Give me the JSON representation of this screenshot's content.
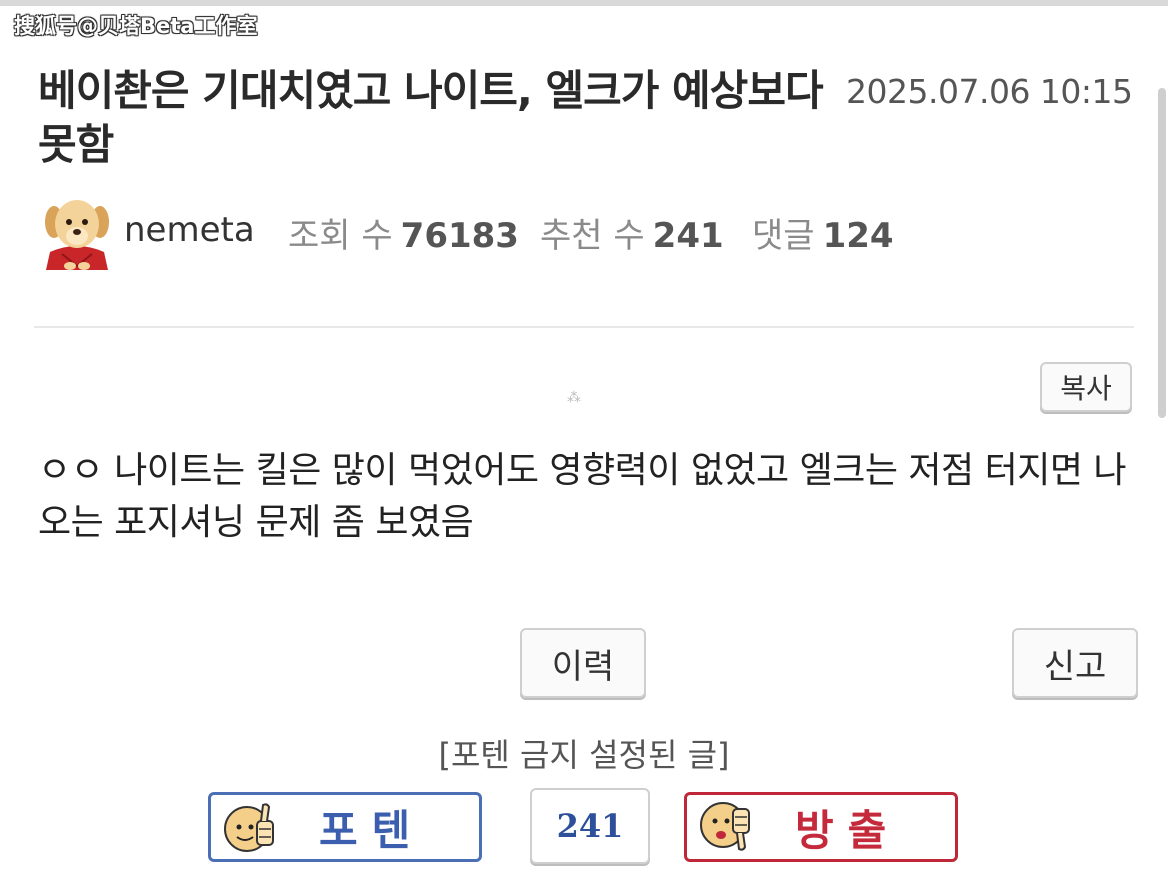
{
  "watermark": "搜狐号@贝塔Beta工作室",
  "post": {
    "title": "베이촨은 기대치였고 나이트, 엘크가 예상보다 못함",
    "datetime": "2025.07.06 10:15",
    "author": "nemeta",
    "stats": {
      "views_label": "조회 수",
      "views_value": "76183",
      "recommend_label": "추천 수",
      "recommend_value": "241",
      "comments_label": "댓글",
      "comments_value": "124"
    },
    "copy_label": "복사",
    "body": "ㅇㅇ 나이트는 킬은 많이 먹었어도 영향력이 없었고 엘크는 저점 터지면 나오는 포지셔닝 문제 좀 보였음"
  },
  "actions": {
    "history_label": "이력",
    "report_label": "신고"
  },
  "vote": {
    "notice": "[포텐 금지 설정된 글]",
    "up_label": "포텐",
    "count": "241",
    "down_label": "방출"
  },
  "icons": {
    "avatar": "puppy-avatar-icon",
    "thumbs_up": "thumbs-up-face-icon",
    "thumbs_down": "thumbs-down-face-icon"
  },
  "colors": {
    "upvote": "#4a6fb5",
    "downvote": "#c0283a"
  }
}
